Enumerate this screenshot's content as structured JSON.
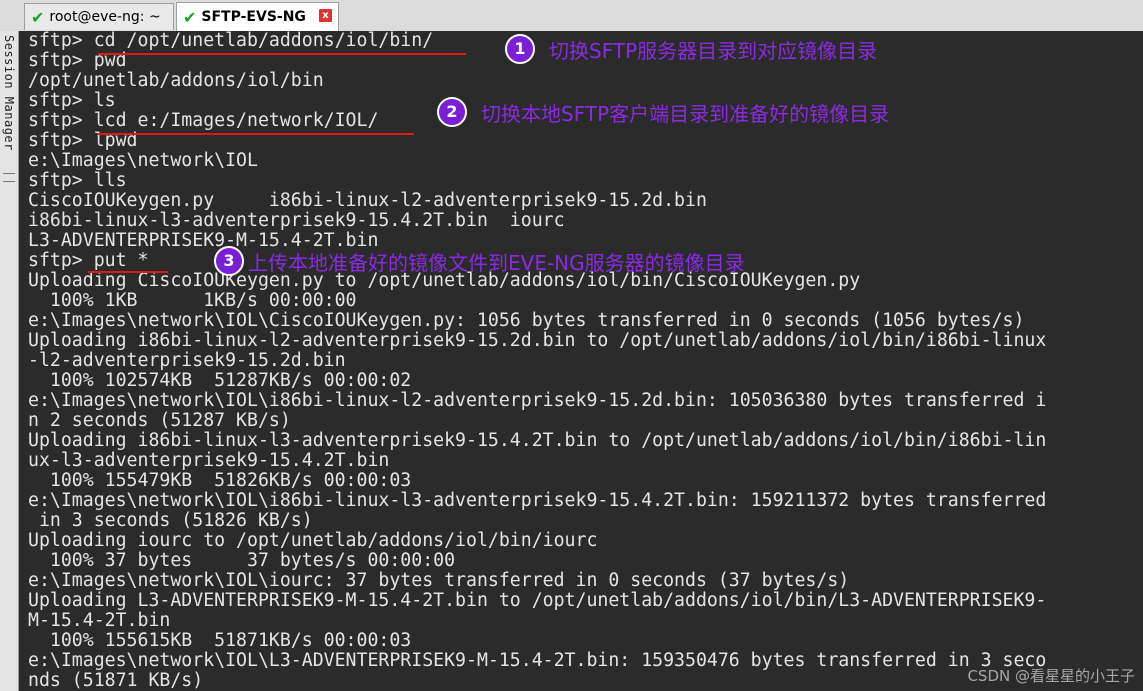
{
  "tabs": [
    {
      "label": "root@eve-ng: ~",
      "status_icon": "check-icon"
    },
    {
      "label": "SFTP-EVS-NG",
      "status_icon": "check-icon",
      "close_glyph": "x"
    }
  ],
  "sidebar": {
    "label": "Session Manager"
  },
  "terminal": {
    "lines": [
      "sftp> cd /opt/unetlab/addons/iol/bin/",
      "sftp> pwd",
      "/opt/unetlab/addons/iol/bin",
      "sftp> ls",
      "sftp> lcd e:/Images/network/IOL/",
      "sftp> lpwd",
      "e:\\Images\\network\\IOL",
      "sftp> lls",
      "CiscoIOUKeygen.py     i86bi-linux-l2-adventerprisek9-15.2d.bin",
      "i86bi-linux-l3-adventerprisek9-15.4.2T.bin  iourc",
      "L3-ADVENTERPRISEK9-M-15.4-2T.bin",
      "sftp> put *",
      "Uploading CiscoIOUKeygen.py to /opt/unetlab/addons/iol/bin/CiscoIOUKeygen.py",
      "  100% 1KB      1KB/s 00:00:00",
      "e:\\Images\\network\\IOL\\CiscoIOUKeygen.py: 1056 bytes transferred in 0 seconds (1056 bytes/s)",
      "Uploading i86bi-linux-l2-adventerprisek9-15.2d.bin to /opt/unetlab/addons/iol/bin/i86bi-linux",
      "-l2-adventerprisek9-15.2d.bin",
      "  100% 102574KB  51287KB/s 00:00:02",
      "e:\\Images\\network\\IOL\\i86bi-linux-l2-adventerprisek9-15.2d.bin: 105036380 bytes transferred i",
      "n 2 seconds (51287 KB/s)",
      "Uploading i86bi-linux-l3-adventerprisek9-15.4.2T.bin to /opt/unetlab/addons/iol/bin/i86bi-lin",
      "ux-l3-adventerprisek9-15.4.2T.bin",
      "  100% 155479KB  51826KB/s 00:00:03",
      "e:\\Images\\network\\IOL\\i86bi-linux-l3-adventerprisek9-15.4.2T.bin: 159211372 bytes transferred",
      " in 3 seconds (51826 KB/s)",
      "Uploading iourc to /opt/unetlab/addons/iol/bin/iourc",
      "  100% 37 bytes     37 bytes/s 00:00:00",
      "e:\\Images\\network\\IOL\\iourc: 37 bytes transferred in 0 seconds (37 bytes/s)",
      "Uploading L3-ADVENTERPRISEK9-M-15.4-2T.bin to /opt/unetlab/addons/iol/bin/L3-ADVENTERPRISEK9-",
      "M-15.4-2T.bin",
      "  100% 155615KB  51871KB/s 00:00:03",
      "e:\\Images\\network\\IOL\\L3-ADVENTERPRISEK9-M-15.4-2T.bin: 159350476 bytes transferred in 3 seco",
      "nds (51871 KB/s)"
    ]
  },
  "annotations": [
    {
      "num": "1",
      "text": "切换SFTP服务器目录到对应镜像目录"
    },
    {
      "num": "2",
      "text": "切换本地SFTP客户端目录到准备好的镜像目录"
    },
    {
      "num": "3",
      "text": "上传本地准备好的镜像文件到EVE-NG服务器的镜像目录"
    }
  ],
  "watermark": "CSDN @看星星的小王子",
  "colors": {
    "annotation": "#8a2be2",
    "underline": "#e01818",
    "terminal_bg": "#2b2b2b",
    "terminal_text": "#e4e4e4"
  }
}
